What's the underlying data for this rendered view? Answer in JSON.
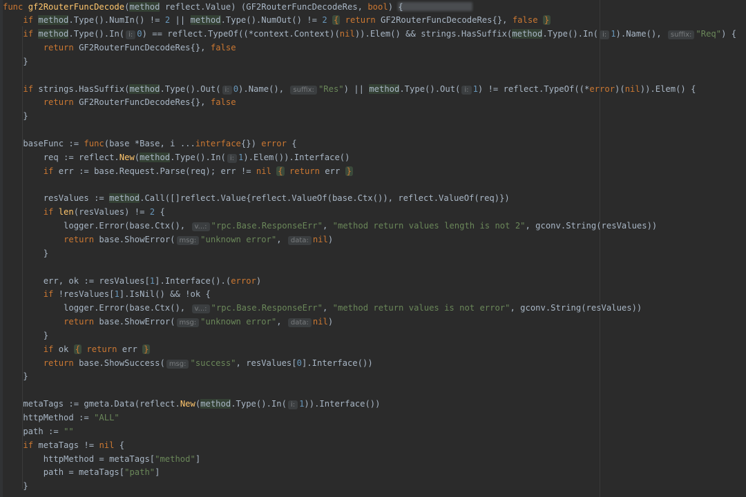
{
  "editor": {
    "theme_colors": {
      "background": "#2b2b2b",
      "keyword": "#cc7832",
      "function": "#ffc66d",
      "string": "#6a8759",
      "number": "#6897bb",
      "text": "#a9b7c6",
      "hint": "#787b7d"
    },
    "lines": [
      [
        {
          "c": "kw",
          "t": "func "
        },
        {
          "c": "fn",
          "t": "gf2RouterFuncDecode"
        },
        {
          "c": "",
          "t": "("
        },
        {
          "c": "hl",
          "t": "method"
        },
        {
          "c": "",
          "t": " reflect."
        },
        {
          "c": "typ",
          "t": "Value"
        },
        {
          "c": "",
          "t": ") (GF2RouterFuncDecodeRes, "
        },
        {
          "c": "kw",
          "t": "bool"
        },
        {
          "c": "",
          "t": ") {"
        }
      ],
      [
        {
          "c": "",
          "t": "    "
        },
        {
          "c": "kw",
          "t": "if "
        },
        {
          "c": "hl",
          "t": "method"
        },
        {
          "c": "",
          "t": ".Type().NumIn() != "
        },
        {
          "c": "num",
          "t": "2"
        },
        {
          "c": "",
          "t": " || "
        },
        {
          "c": "hl",
          "t": "method"
        },
        {
          "c": "",
          "t": ".Type().NumOut() != "
        },
        {
          "c": "num",
          "t": "2"
        },
        {
          "c": "",
          "t": " "
        },
        {
          "c": "fold",
          "t": "{"
        },
        {
          "c": "kw",
          "t": " return"
        },
        {
          "c": "",
          "t": " GF2RouterFuncDecodeRes{}, "
        },
        {
          "c": "kw",
          "t": "false"
        },
        {
          "c": "",
          "t": " "
        },
        {
          "c": "fold",
          "t": "}"
        }
      ],
      [
        {
          "c": "",
          "t": "    "
        },
        {
          "c": "kw",
          "t": "if "
        },
        {
          "c": "hl",
          "t": "method"
        },
        {
          "c": "",
          "t": ".Type().In("
        },
        {
          "c": "hint",
          "t": "i:"
        },
        {
          "c": "num",
          "t": "0"
        },
        {
          "c": "",
          "t": ") == reflect.TypeOf((*context.Context)("
        },
        {
          "c": "kw",
          "t": "nil"
        },
        {
          "c": "",
          "t": ")).Elem() && strings.HasSuffix("
        },
        {
          "c": "hl",
          "t": "method"
        },
        {
          "c": "",
          "t": ".Type().In("
        },
        {
          "c": "hint",
          "t": "i:"
        },
        {
          "c": "num",
          "t": "1"
        },
        {
          "c": "",
          "t": ").Name(), "
        },
        {
          "c": "hint",
          "t": "suffix:"
        },
        {
          "c": "str",
          "t": "\"Req\""
        },
        {
          "c": "",
          "t": ") {"
        }
      ],
      [
        {
          "c": "",
          "t": "        "
        },
        {
          "c": "kw",
          "t": "return"
        },
        {
          "c": "",
          "t": " GF2RouterFuncDecodeRes{}, "
        },
        {
          "c": "kw",
          "t": "false"
        }
      ],
      [
        {
          "c": "",
          "t": "    }"
        }
      ],
      [],
      [
        {
          "c": "",
          "t": "    "
        },
        {
          "c": "kw",
          "t": "if "
        },
        {
          "c": "",
          "t": "strings.HasSuffix("
        },
        {
          "c": "hl",
          "t": "method"
        },
        {
          "c": "",
          "t": ".Type().Out("
        },
        {
          "c": "hint",
          "t": "i:"
        },
        {
          "c": "num",
          "t": "0"
        },
        {
          "c": "",
          "t": ").Name(), "
        },
        {
          "c": "hint",
          "t": "suffix:"
        },
        {
          "c": "str",
          "t": "\"Res\""
        },
        {
          "c": "",
          "t": ") || "
        },
        {
          "c": "hl",
          "t": "method"
        },
        {
          "c": "",
          "t": ".Type().Out("
        },
        {
          "c": "hint",
          "t": "i:"
        },
        {
          "c": "num",
          "t": "1"
        },
        {
          "c": "",
          "t": ") != reflect.TypeOf((*"
        },
        {
          "c": "kw",
          "t": "error"
        },
        {
          "c": "",
          "t": ")("
        },
        {
          "c": "kw",
          "t": "nil"
        },
        {
          "c": "",
          "t": ")).Elem() {"
        }
      ],
      [
        {
          "c": "",
          "t": "        "
        },
        {
          "c": "kw",
          "t": "return"
        },
        {
          "c": "",
          "t": " GF2RouterFuncDecodeRes{}, "
        },
        {
          "c": "kw",
          "t": "false"
        }
      ],
      [
        {
          "c": "",
          "t": "    }"
        }
      ],
      [],
      [
        {
          "c": "",
          "t": "    baseFunc := "
        },
        {
          "c": "kw",
          "t": "func"
        },
        {
          "c": "",
          "t": "(base *Base, i ..."
        },
        {
          "c": "kw",
          "t": "interface"
        },
        {
          "c": "",
          "t": "{}) "
        },
        {
          "c": "kw",
          "t": "error"
        },
        {
          "c": "",
          "t": " {"
        }
      ],
      [
        {
          "c": "",
          "t": "        req := reflect."
        },
        {
          "c": "fn",
          "t": "New"
        },
        {
          "c": "",
          "t": "("
        },
        {
          "c": "hl",
          "t": "method"
        },
        {
          "c": "",
          "t": ".Type().In("
        },
        {
          "c": "hint",
          "t": "i:"
        },
        {
          "c": "num",
          "t": "1"
        },
        {
          "c": "",
          "t": ").Elem()).Interface()"
        }
      ],
      [
        {
          "c": "",
          "t": "        "
        },
        {
          "c": "kw",
          "t": "if "
        },
        {
          "c": "",
          "t": "err := base.Request.Parse(req); err != "
        },
        {
          "c": "kw",
          "t": "nil"
        },
        {
          "c": "",
          "t": " "
        },
        {
          "c": "fold",
          "t": "{"
        },
        {
          "c": "kw",
          "t": " return"
        },
        {
          "c": "",
          "t": " err "
        },
        {
          "c": "fold",
          "t": "}"
        }
      ],
      [],
      [
        {
          "c": "",
          "t": "        resValues := "
        },
        {
          "c": "hl",
          "t": "method"
        },
        {
          "c": "",
          "t": ".Call([]reflect.Value{reflect.ValueOf(base.Ctx()), reflect.ValueOf(req)})"
        }
      ],
      [
        {
          "c": "",
          "t": "        "
        },
        {
          "c": "kw",
          "t": "if "
        },
        {
          "c": "fn",
          "t": "len"
        },
        {
          "c": "",
          "t": "(resValues) != "
        },
        {
          "c": "num",
          "t": "2"
        },
        {
          "c": "",
          "t": " {"
        }
      ],
      [
        {
          "c": "",
          "t": "            logger.Error(base.Ctx(), "
        },
        {
          "c": "hint",
          "t": "v...:"
        },
        {
          "c": "str",
          "t": "\"rpc.Base.ResponseErr\""
        },
        {
          "c": "",
          "t": ", "
        },
        {
          "c": "str",
          "t": "\"method return values length is not 2\""
        },
        {
          "c": "",
          "t": ", gconv.String(resValues))"
        }
      ],
      [
        {
          "c": "",
          "t": "            "
        },
        {
          "c": "kw",
          "t": "return"
        },
        {
          "c": "",
          "t": " base.ShowError("
        },
        {
          "c": "hint",
          "t": "msg:"
        },
        {
          "c": "str",
          "t": "\"unknown error\""
        },
        {
          "c": "",
          "t": ", "
        },
        {
          "c": "hint",
          "t": "data:"
        },
        {
          "c": "kw",
          "t": "nil"
        },
        {
          "c": "",
          "t": ")"
        }
      ],
      [
        {
          "c": "",
          "t": "        }"
        }
      ],
      [],
      [
        {
          "c": "",
          "t": "        err, ok := resValues["
        },
        {
          "c": "num",
          "t": "1"
        },
        {
          "c": "",
          "t": "].Interface().("
        },
        {
          "c": "kw",
          "t": "error"
        },
        {
          "c": "",
          "t": ")"
        }
      ],
      [
        {
          "c": "",
          "t": "        "
        },
        {
          "c": "kw",
          "t": "if "
        },
        {
          "c": "",
          "t": "!resValues["
        },
        {
          "c": "num",
          "t": "1"
        },
        {
          "c": "",
          "t": "].IsNil() && !ok {"
        }
      ],
      [
        {
          "c": "",
          "t": "            logger.Error(base.Ctx(), "
        },
        {
          "c": "hint",
          "t": "v...:"
        },
        {
          "c": "str",
          "t": "\"rpc.Base.ResponseErr\""
        },
        {
          "c": "",
          "t": ", "
        },
        {
          "c": "str",
          "t": "\"method return values is not error\""
        },
        {
          "c": "",
          "t": ", gconv.String(resValues))"
        }
      ],
      [
        {
          "c": "",
          "t": "            "
        },
        {
          "c": "kw",
          "t": "return"
        },
        {
          "c": "",
          "t": " base.ShowError("
        },
        {
          "c": "hint",
          "t": "msg:"
        },
        {
          "c": "str",
          "t": "\"unknown error\""
        },
        {
          "c": "",
          "t": ", "
        },
        {
          "c": "hint",
          "t": "data:"
        },
        {
          "c": "kw",
          "t": "nil"
        },
        {
          "c": "",
          "t": ")"
        }
      ],
      [
        {
          "c": "",
          "t": "        }"
        }
      ],
      [
        {
          "c": "",
          "t": "        "
        },
        {
          "c": "kw",
          "t": "if "
        },
        {
          "c": "",
          "t": "ok "
        },
        {
          "c": "fold",
          "t": "{"
        },
        {
          "c": "kw",
          "t": " return"
        },
        {
          "c": "",
          "t": " err "
        },
        {
          "c": "fold",
          "t": "}"
        }
      ],
      [
        {
          "c": "",
          "t": "        "
        },
        {
          "c": "kw",
          "t": "return"
        },
        {
          "c": "",
          "t": " base.ShowSuccess("
        },
        {
          "c": "hint",
          "t": "msg:"
        },
        {
          "c": "str",
          "t": "\"success\""
        },
        {
          "c": "",
          "t": ", resValues["
        },
        {
          "c": "num",
          "t": "0"
        },
        {
          "c": "",
          "t": "].Interface())"
        }
      ],
      [
        {
          "c": "",
          "t": "    }"
        }
      ],
      [],
      [
        {
          "c": "",
          "t": "    metaTags := gmeta.Data(reflect."
        },
        {
          "c": "fn",
          "t": "New"
        },
        {
          "c": "",
          "t": "("
        },
        {
          "c": "hl",
          "t": "method"
        },
        {
          "c": "",
          "t": ".Type().In("
        },
        {
          "c": "hint",
          "t": "i:"
        },
        {
          "c": "num",
          "t": "1"
        },
        {
          "c": "",
          "t": ")).Interface())"
        }
      ],
      [
        {
          "c": "",
          "t": "    httpMethod := "
        },
        {
          "c": "str",
          "t": "\"ALL\""
        }
      ],
      [
        {
          "c": "",
          "t": "    path := "
        },
        {
          "c": "str",
          "t": "\"\""
        }
      ],
      [
        {
          "c": "",
          "t": "    "
        },
        {
          "c": "kw",
          "t": "if "
        },
        {
          "c": "",
          "t": "metaTags != "
        },
        {
          "c": "kw",
          "t": "nil"
        },
        {
          "c": "",
          "t": " {"
        }
      ],
      [
        {
          "c": "",
          "t": "        httpMethod = metaTags["
        },
        {
          "c": "str",
          "t": "\"method\""
        },
        {
          "c": "",
          "t": "]"
        }
      ],
      [
        {
          "c": "",
          "t": "        path = metaTags["
        },
        {
          "c": "str",
          "t": "\"path\""
        },
        {
          "c": "",
          "t": "]"
        }
      ],
      [
        {
          "c": "",
          "t": "    }"
        }
      ]
    ]
  }
}
